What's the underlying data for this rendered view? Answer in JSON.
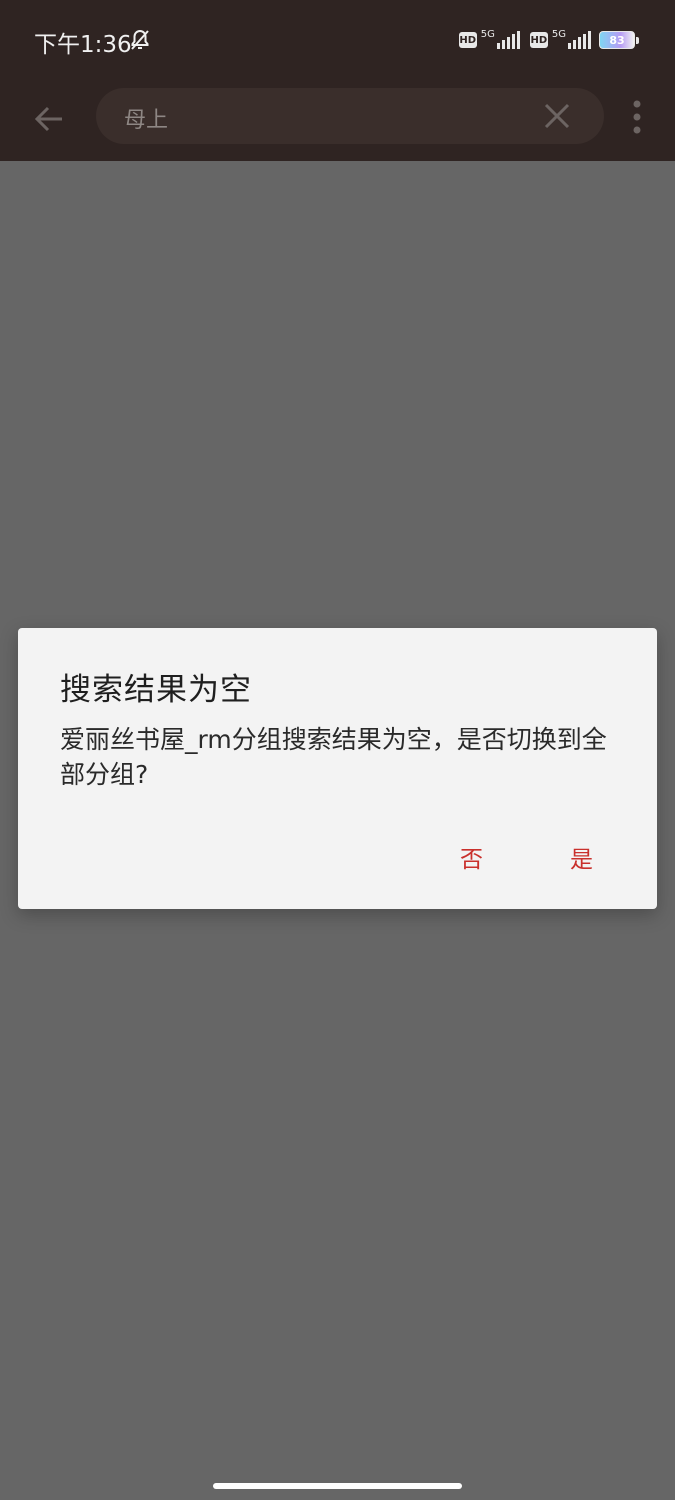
{
  "status_bar": {
    "time": "下午1:36",
    "network_1": "5G",
    "network_2": "5G",
    "hd_label": "HD",
    "battery": "83"
  },
  "app_bar": {
    "search_query": "母上"
  },
  "dialog": {
    "title": "搜索结果为空",
    "message": "爱丽丝书屋_rm分组搜索结果为空，是否切换到全部分组?",
    "no_label": "否",
    "yes_label": "是",
    "accent_color": "#c9302c"
  },
  "icons": [
    "bell-off-icon",
    "arrow-left-icon",
    "close-icon",
    "more-vert-icon",
    "signal-icon",
    "battery-icon"
  ]
}
